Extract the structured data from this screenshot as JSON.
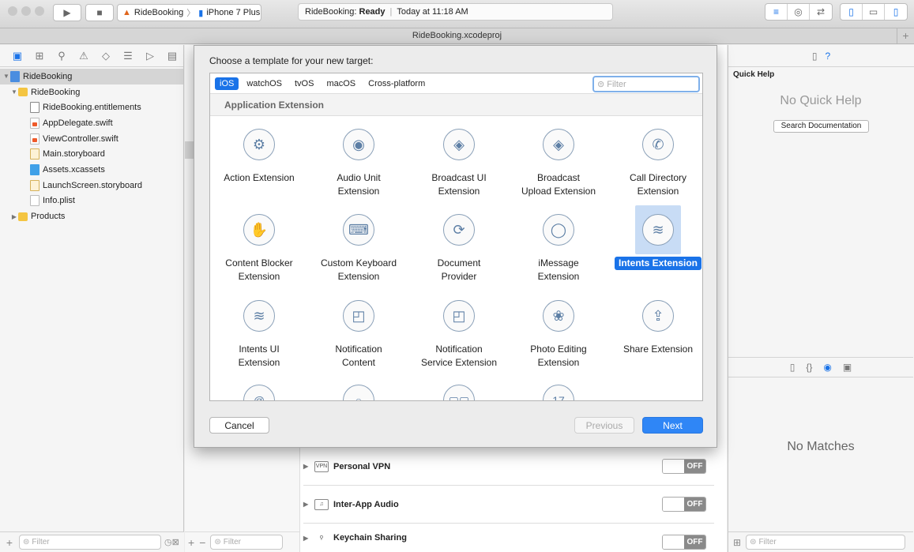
{
  "toolbar": {
    "scheme_name": "RideBooking",
    "device": "iPhone 7 Plus",
    "status_app": "RideBooking:",
    "status_state": "Ready",
    "status_time": "Today at 11:18 AM",
    "play_icon": "play-icon",
    "stop_icon": "stop-icon"
  },
  "tabbar": {
    "title": "RideBooking.xcodeproj",
    "plus": "+"
  },
  "navigator": {
    "items": [
      {
        "label": "RideBooking"
      },
      {
        "label": "RideBooking"
      },
      {
        "label": "RideBooking.entitlements"
      },
      {
        "label": "AppDelegate.swift"
      },
      {
        "label": "ViewController.swift"
      },
      {
        "label": "Main.storyboard"
      },
      {
        "label": "Assets.xcassets"
      },
      {
        "label": "LaunchScreen.storyboard"
      },
      {
        "label": "Info.plist"
      },
      {
        "label": "Products"
      }
    ],
    "filter_placeholder": "Filter"
  },
  "editor": {
    "filter_placeholder": "Filter",
    "capabilities": [
      {
        "label": "Personal VPN",
        "icon_text": "VPN",
        "state": "OFF"
      },
      {
        "label": "Inter-App Audio",
        "icon_text": "",
        "state": "OFF"
      },
      {
        "label": "Keychain Sharing",
        "icon_text": "",
        "state": "OFF"
      }
    ]
  },
  "inspector": {
    "title": "Quick Help",
    "no_help": "No Quick Help",
    "search_docs": "Search Documentation",
    "no_matches": "No Matches",
    "filter_placeholder": "Filter"
  },
  "sheet": {
    "title": "Choose a template for your new target:",
    "platforms": [
      "iOS",
      "watchOS",
      "tvOS",
      "macOS",
      "Cross-platform"
    ],
    "filter_placeholder": "Filter",
    "section": "Application Extension",
    "templates": [
      {
        "label1": "Action Extension",
        "label2": "",
        "icon": "gear-icon",
        "glyph": "⚙"
      },
      {
        "label1": "Audio Unit",
        "label2": "Extension",
        "icon": "audio-wave-icon",
        "glyph": "◉"
      },
      {
        "label1": "Broadcast UI",
        "label2": "Extension",
        "icon": "broadcast-icon",
        "glyph": "◈"
      },
      {
        "label1": "Broadcast",
        "label2": "Upload Extension",
        "icon": "broadcast-upload-icon",
        "glyph": "◈"
      },
      {
        "label1": "Call Directory",
        "label2": "Extension",
        "icon": "phone-icon",
        "glyph": "✆"
      },
      {
        "label1": "Content Blocker",
        "label2": "Extension",
        "icon": "hand-icon",
        "glyph": "✋"
      },
      {
        "label1": "Custom Keyboard",
        "label2": "Extension",
        "icon": "keyboard-icon",
        "glyph": "⌨"
      },
      {
        "label1": "Document",
        "label2": "Provider",
        "icon": "refresh-icon",
        "glyph": "⟳"
      },
      {
        "label1": "iMessage",
        "label2": "Extension",
        "icon": "speech-bubble-icon",
        "glyph": "◯"
      },
      {
        "label1": "Intents Extension",
        "label2": "",
        "icon": "intents-wave-icon",
        "glyph": "≋"
      },
      {
        "label1": "Intents UI",
        "label2": "Extension",
        "icon": "intents-ui-wave-icon",
        "glyph": "≋"
      },
      {
        "label1": "Notification",
        "label2": "Content",
        "icon": "notification-icon",
        "glyph": "◰"
      },
      {
        "label1": "Notification",
        "label2": "Service Extension",
        "icon": "notification-service-icon",
        "glyph": "◰"
      },
      {
        "label1": "Photo Editing",
        "label2": "Extension",
        "icon": "flower-icon",
        "glyph": "❀"
      },
      {
        "label1": "Share Extension",
        "label2": "",
        "icon": "share-icon",
        "glyph": "⇪"
      }
    ],
    "partial_row": [
      {
        "icon": "at-icon",
        "glyph": "@"
      },
      {
        "icon": "circle-icon",
        "glyph": "○"
      },
      {
        "icon": "grid-icon",
        "glyph": "▢▢"
      },
      {
        "icon": "calendar-icon",
        "glyph": "17"
      }
    ],
    "cancel": "Cancel",
    "previous": "Previous",
    "next": "Next"
  }
}
